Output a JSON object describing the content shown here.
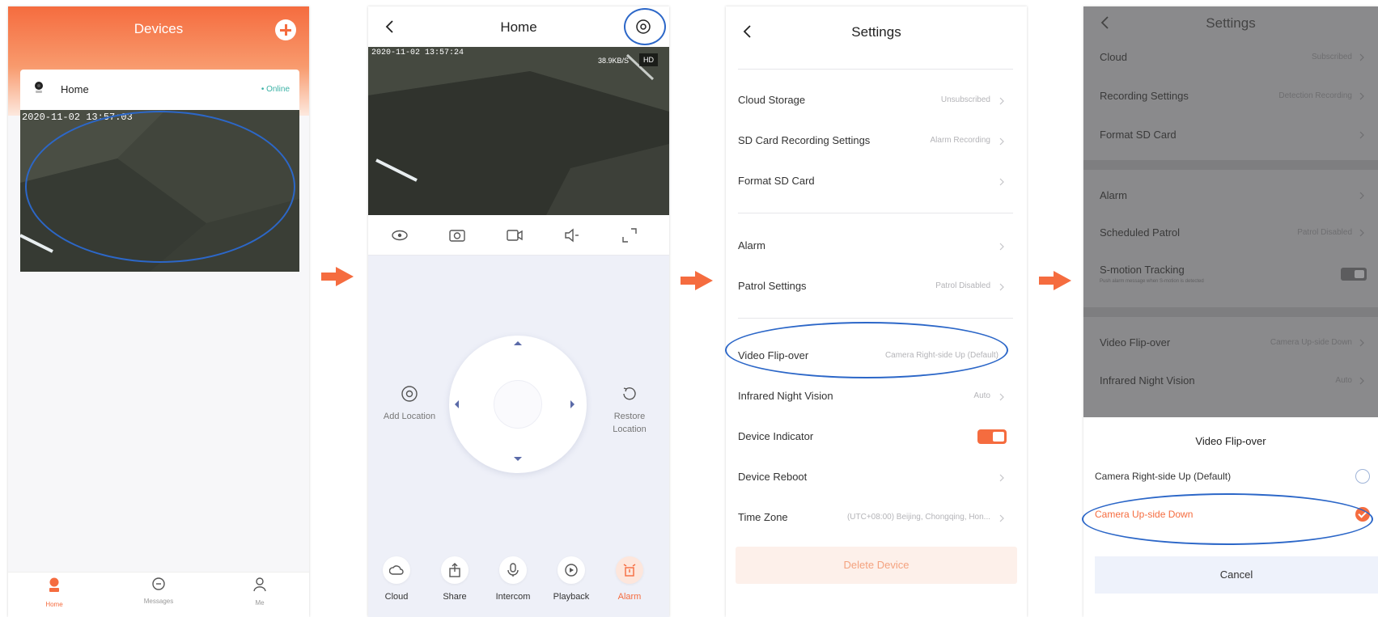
{
  "colors": {
    "accent": "#f56c3f",
    "highlight": "#2c67c8",
    "online": "#3bb2a6"
  },
  "step1": {
    "title": "Devices",
    "device": {
      "name": "Home",
      "status": "Online",
      "timestamp": "2020-11-02 13:57:03"
    },
    "tabs": [
      {
        "label": "Home",
        "icon": "home-icon"
      },
      {
        "label": "Messages",
        "icon": "messages-icon"
      },
      {
        "label": "Me",
        "icon": "profile-icon"
      }
    ]
  },
  "step2": {
    "title": "Home",
    "timestamp": "2020-11-02 13:57:24",
    "rate": "38.9KB/S",
    "quality": "HD",
    "controls": [
      "eye-icon",
      "camera-icon",
      "record-icon",
      "mute-icon",
      "fullscreen-icon"
    ],
    "add_location": "Add Location",
    "restore_location": "Restore Location",
    "bottom": [
      {
        "label": "Cloud",
        "icon": "cloud-icon"
      },
      {
        "label": "Share",
        "icon": "share-icon"
      },
      {
        "label": "Intercom",
        "icon": "microphone-icon"
      },
      {
        "label": "Playback",
        "icon": "playback-icon"
      },
      {
        "label": "Alarm",
        "icon": "alarm-icon"
      }
    ]
  },
  "step3": {
    "title": "Settings",
    "rows": [
      {
        "label": "Cloud Storage",
        "value": "Unsubscribed"
      },
      {
        "label": "SD Card Recording Settings",
        "value": "Alarm Recording"
      },
      {
        "label": "Format SD Card",
        "value": ""
      },
      {
        "label": "Alarm",
        "value": ""
      },
      {
        "label": "Patrol Settings",
        "value": "Patrol Disabled"
      },
      {
        "label": "Video Flip-over",
        "value": "Camera Right-side Up (Default)"
      },
      {
        "label": "Infrared Night Vision",
        "value": "Auto"
      },
      {
        "label": "Device Indicator",
        "value": ""
      },
      {
        "label": "Device Reboot",
        "value": ""
      },
      {
        "label": "Time Zone",
        "value": "(UTC+08:00) Beijing, Chongqing, Hon..."
      }
    ],
    "delete_label": "Delete Device"
  },
  "step4": {
    "title": "Settings",
    "rows": [
      {
        "label": "Cloud",
        "value": "Subscribed"
      },
      {
        "label": "Recording Settings",
        "value": "Detection Recording"
      },
      {
        "label": "Format SD Card",
        "value": ""
      },
      {
        "label": "Alarm",
        "value": ""
      },
      {
        "label": "Scheduled Patrol",
        "value": "Patrol Disabled"
      },
      {
        "label": "S-motion Tracking",
        "value": ""
      },
      {
        "label": "Video Flip-over",
        "value": "Camera Up-side Down"
      },
      {
        "label": "Infrared Night Vision",
        "value": "Auto"
      }
    ],
    "smotion_sub": "Push alarm message when S-motion is detected",
    "sheet_title": "Video Flip-over",
    "options": [
      "Camera Right-side Up (Default)",
      "Camera Up-side Down"
    ],
    "cancel_label": "Cancel"
  }
}
